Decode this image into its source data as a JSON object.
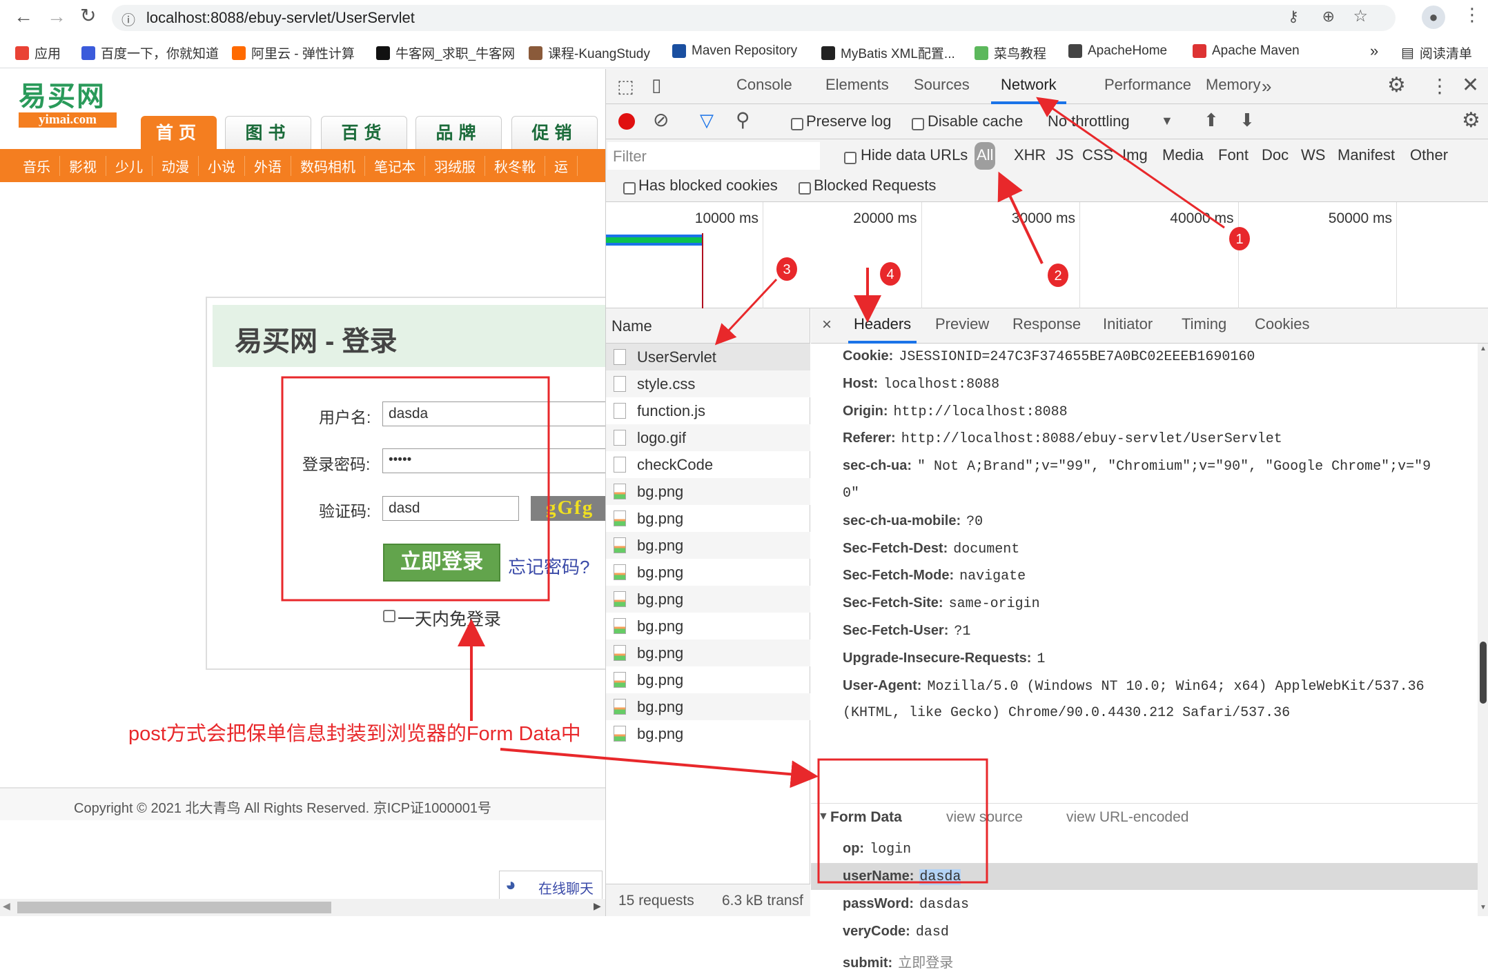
{
  "browser": {
    "url": "localhost:8088/ebuy-servlet/UserServlet",
    "bookmarks": [
      "应用",
      "百度一下，你就知道",
      "阿里云 - 弹性计算",
      "牛客网_求职_牛客网",
      "课程-KuangStudy",
      "Maven Repository",
      "MyBatis XML配置...",
      "菜鸟教程",
      "ApacheHome",
      "Apache Maven"
    ],
    "more_bookmarks": "»",
    "reading_list": "阅读清单"
  },
  "site": {
    "logo_text": "易买网",
    "logo_domain": "yimai.com",
    "nav_tabs": [
      "首页",
      "图书",
      "百货",
      "品牌",
      "促销"
    ],
    "active_tab": 0,
    "categories": [
      "音乐",
      "影视",
      "少儿",
      "动漫",
      "小说",
      "外语",
      "数码相机",
      "笔记本",
      "羽绒服",
      "秋冬靴",
      "运"
    ],
    "login": {
      "title": "易买网 - 登录",
      "username_label": "用户名:",
      "username_value": "dasda",
      "password_label": "登录密码:",
      "password_value": "•••••",
      "code_label": "验证码:",
      "code_value": "dasd",
      "captcha_text": "gGfg",
      "submit_label": "立即登录",
      "forgot_label": "忘记密码?",
      "remember_label": "一天内免登录"
    },
    "footer": "Copyright © 2021 北大青鸟 All Rights Reserved. 京ICP证1000001号",
    "chat_label": "在线聊天"
  },
  "annotation": {
    "note": "post方式会把保单信息封装到浏览器的Form Data中",
    "markers": [
      "1",
      "2",
      "3",
      "4"
    ],
    "color": "#e8282b"
  },
  "devtools": {
    "tabs": [
      "Console",
      "Elements",
      "Sources",
      "Network",
      "Performance",
      "Memory"
    ],
    "more_tabs": "»",
    "active_tab": "Network",
    "preserve_log": "Preserve log",
    "disable_cache": "Disable cache",
    "throttling": "No throttling",
    "filter_placeholder": "Filter",
    "hide_data_urls": "Hide data URLs",
    "type_filters": [
      "All",
      "XHR",
      "JS",
      "CSS",
      "Img",
      "Media",
      "Font",
      "Doc",
      "WS",
      "Manifest",
      "Other"
    ],
    "has_blocked_cookies": "Has blocked cookies",
    "blocked_requests": "Blocked Requests",
    "timeline_ticks": [
      "10000 ms",
      "20000 ms",
      "30000 ms",
      "40000 ms",
      "50000 ms"
    ],
    "name_header": "Name",
    "requests": [
      "UserServlet",
      "style.css",
      "function.js",
      "logo.gif",
      "checkCode",
      "bg.png",
      "bg.png",
      "bg.png",
      "bg.png",
      "bg.png",
      "bg.png",
      "bg.png",
      "bg.png",
      "bg.png",
      "bg.png"
    ],
    "status_requests": "15 requests",
    "status_transfer": "6.3 kB transf",
    "detail_close": "×",
    "detail_tabs": [
      "Headers",
      "Preview",
      "Response",
      "Initiator",
      "Timing",
      "Cookies"
    ],
    "headers": [
      {
        "k": "Cookie:",
        "v": "JSESSIONID=247C3F374655BE7A0BC02EEEB1690160"
      },
      {
        "k": "Host:",
        "v": "localhost:8088"
      },
      {
        "k": "Origin:",
        "v": "http://localhost:8088"
      },
      {
        "k": "Referer:",
        "v": "http://localhost:8088/ebuy-servlet/UserServlet"
      },
      {
        "k": "sec-ch-ua:",
        "v": "\" Not A;Brand\";v=\"99\", \"Chromium\";v=\"90\", \"Google Chrome\";v=\"9"
      },
      {
        "k": "",
        "v": "0\""
      },
      {
        "k": "sec-ch-ua-mobile:",
        "v": "?0"
      },
      {
        "k": "Sec-Fetch-Dest:",
        "v": "document"
      },
      {
        "k": "Sec-Fetch-Mode:",
        "v": "navigate"
      },
      {
        "k": "Sec-Fetch-Site:",
        "v": "same-origin"
      },
      {
        "k": "Sec-Fetch-User:",
        "v": "?1"
      },
      {
        "k": "Upgrade-Insecure-Requests:",
        "v": "1"
      },
      {
        "k": "User-Agent:",
        "v": "Mozilla/5.0 (Windows NT 10.0; Win64; x64) AppleWebKit/537.36"
      },
      {
        "k": "",
        "v": "(KHTML, like Gecko) Chrome/90.0.4430.212 Safari/537.36"
      }
    ],
    "form_data": {
      "title": "Form Data",
      "view_source": "view source",
      "view_url_encoded": "view URL-encoded",
      "fields": [
        {
          "k": "op:",
          "v": "login"
        },
        {
          "k": "userName:",
          "v": "dasda"
        },
        {
          "k": "passWord:",
          "v": "dasdas"
        },
        {
          "k": "veryCode:",
          "v": "dasd"
        },
        {
          "k": "submit:",
          "v": "立即登录"
        }
      ]
    }
  }
}
